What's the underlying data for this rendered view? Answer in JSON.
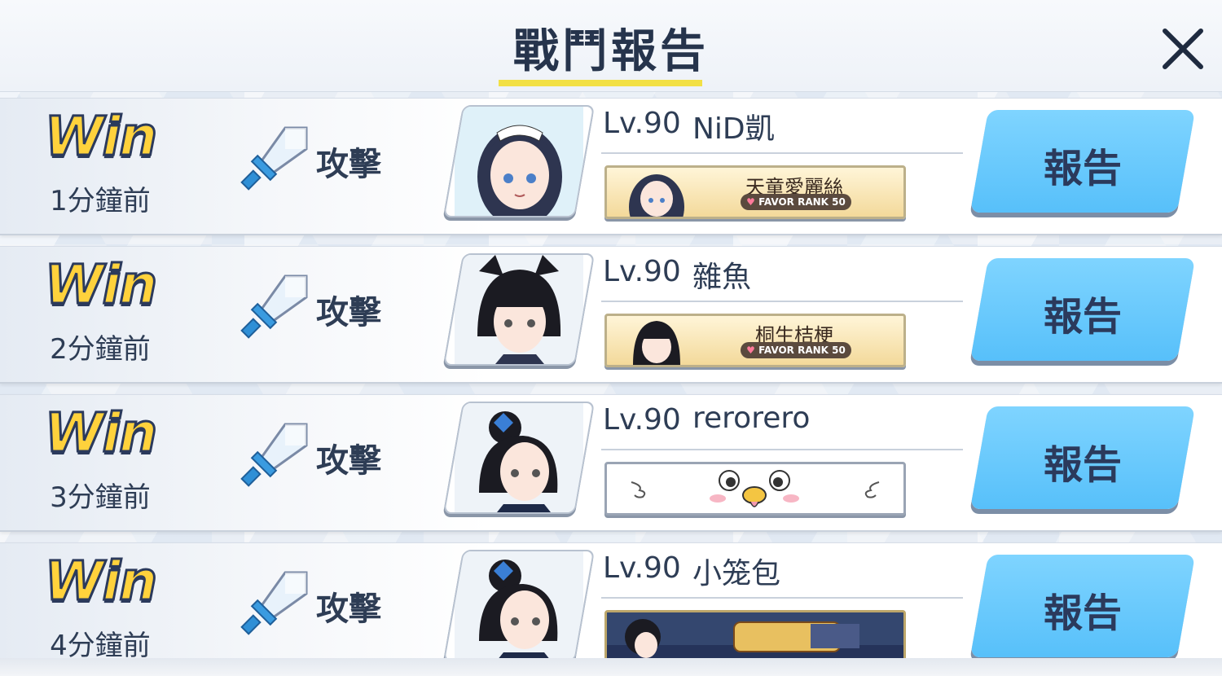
{
  "header": {
    "title": "戰鬥報告",
    "close_icon": "close-icon"
  },
  "accent": {
    "title_underline": "#f2e045",
    "report_button": "#5cc4fb",
    "win_text": "#ffd23c"
  },
  "rows": [
    {
      "result": "Win",
      "time": "1分鐘前",
      "mode": "攻擊",
      "mode_icon": "sword-icon",
      "level": "Lv.90",
      "name": "NiD凱",
      "banner": {
        "style": "favor",
        "character": "天童愛麗絲",
        "favor": "FAVOR RANK 50"
      },
      "report_label": "報告"
    },
    {
      "result": "Win",
      "time": "2分鐘前",
      "mode": "攻擊",
      "mode_icon": "sword-icon",
      "level": "Lv.90",
      "name": "雜魚",
      "banner": {
        "style": "favor",
        "character": "桐生桔梗",
        "favor": "FAVOR RANK 50"
      },
      "report_label": "報告"
    },
    {
      "result": "Win",
      "time": "3分鐘前",
      "mode": "攻擊",
      "mode_icon": "sword-icon",
      "level": "Lv.90",
      "name": "rerorero",
      "banner": {
        "style": "bird",
        "character": "",
        "favor": ""
      },
      "report_label": "報告"
    },
    {
      "result": "Win",
      "time": "4分鐘前",
      "mode": "攻擊",
      "mode_icon": "sword-icon",
      "level": "Lv.90",
      "name": "小笼包",
      "banner": {
        "style": "event",
        "character": "",
        "favor": ""
      },
      "report_label": "報告"
    }
  ]
}
